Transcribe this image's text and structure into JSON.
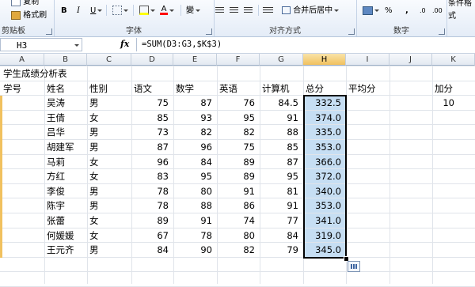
{
  "ribbon": {
    "clipboard": {
      "label": "剪贴板",
      "paste_item": "复制",
      "format_painter": "格式刷"
    },
    "font": {
      "label": "字体",
      "bold": "B",
      "italic": "I",
      "underline": "U",
      "wen": "變"
    },
    "alignment": {
      "label": "对齐方式",
      "merge_center": "合并后居中"
    },
    "number": {
      "label": "数字",
      "percent": "%",
      "comma": ","
    },
    "styles": {
      "conditional": "条件格式"
    }
  },
  "formula_bar": {
    "name_box": "H3",
    "fx": "fx",
    "formula": "=SUM(D3:G3,$K$3)"
  },
  "columns": [
    "A",
    "B",
    "C",
    "D",
    "E",
    "F",
    "G",
    "H",
    "I",
    "J",
    "K"
  ],
  "sheet": {
    "title": "学生成绩分析表",
    "headers": [
      "学号",
      "姓名",
      "性别",
      "语文",
      "数学",
      "英语",
      "计算机",
      "总分",
      "平均分",
      "",
      "加分"
    ],
    "bonus": "10",
    "rows": [
      {
        "name": "吴涛",
        "gender": "男",
        "chinese": "75",
        "math": "87",
        "english": "76",
        "computer": "84.5",
        "total": "332.5"
      },
      {
        "name": "王倩",
        "gender": "女",
        "chinese": "85",
        "math": "93",
        "english": "95",
        "computer": "91",
        "total": "374.0"
      },
      {
        "name": "吕华",
        "gender": "男",
        "chinese": "73",
        "math": "82",
        "english": "82",
        "computer": "88",
        "total": "335.0"
      },
      {
        "name": "胡建军",
        "gender": "男",
        "chinese": "87",
        "math": "96",
        "english": "75",
        "computer": "85",
        "total": "353.0"
      },
      {
        "name": "马莉",
        "gender": "女",
        "chinese": "96",
        "math": "84",
        "english": "89",
        "computer": "87",
        "total": "366.0"
      },
      {
        "name": "方红",
        "gender": "女",
        "chinese": "83",
        "math": "95",
        "english": "89",
        "computer": "95",
        "total": "372.0"
      },
      {
        "name": "李俊",
        "gender": "男",
        "chinese": "78",
        "math": "80",
        "english": "91",
        "computer": "81",
        "total": "340.0"
      },
      {
        "name": "陈宇",
        "gender": "男",
        "chinese": "78",
        "math": "88",
        "english": "86",
        "computer": "91",
        "total": "353.0"
      },
      {
        "name": "张蕾",
        "gender": "女",
        "chinese": "89",
        "math": "91",
        "english": "74",
        "computer": "77",
        "total": "341.0"
      },
      {
        "name": "何媛媛",
        "gender": "女",
        "chinese": "67",
        "math": "78",
        "english": "80",
        "computer": "84",
        "total": "319.0"
      },
      {
        "name": "王元齐",
        "gender": "男",
        "chinese": "84",
        "math": "90",
        "english": "82",
        "computer": "79",
        "total": "345.0"
      }
    ]
  },
  "colors": {
    "selection_fill": "#c6def3",
    "header_highlight": "#f1c15f",
    "ribbon_bg": "#e4ecf7"
  }
}
